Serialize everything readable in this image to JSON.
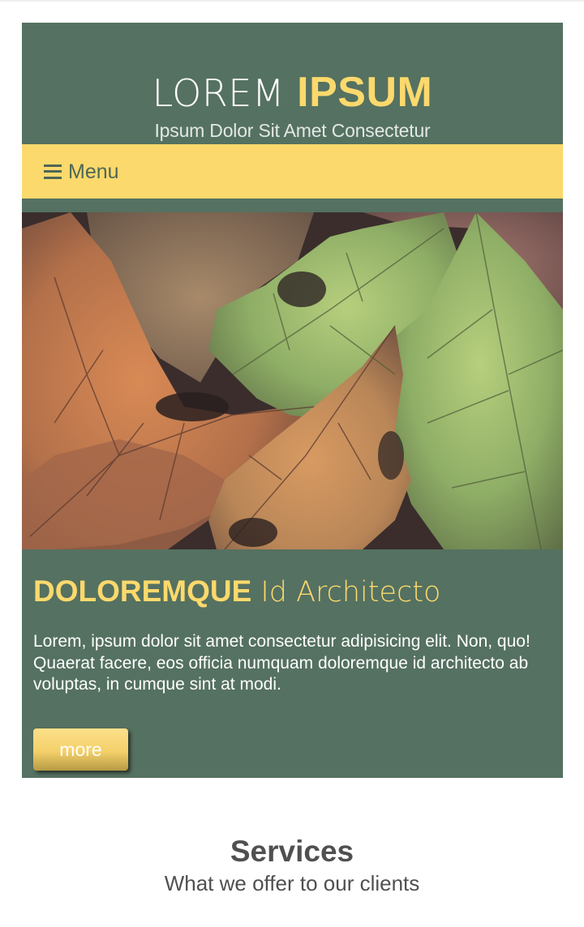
{
  "header": {
    "title_light": "LOREM ",
    "title_bold": "IPSUM",
    "tagline": "Ipsum Dolor Sit Amet Consectetur"
  },
  "nav": {
    "menu_icon": "hamburger-icon",
    "menu_label": "Menu"
  },
  "hero": {
    "image_subject": "autumn-leaves-photo"
  },
  "feature": {
    "heading_bold": "DOLOREMQUE",
    "heading_light": " Id Architecto",
    "body": "Lorem, ipsum dolor sit amet consectetur adipisicing elit. Non, quo! Quaerat facere, eos officia numquam doloremque id architecto ab voluptas, in cumque sint at modi.",
    "button_label": "more"
  },
  "services": {
    "title": "Services",
    "subtitle": "What we offer to our clients"
  },
  "colors": {
    "primary_green": "#557161",
    "accent_yellow": "#fcd96c",
    "text_dark": "#505050"
  }
}
